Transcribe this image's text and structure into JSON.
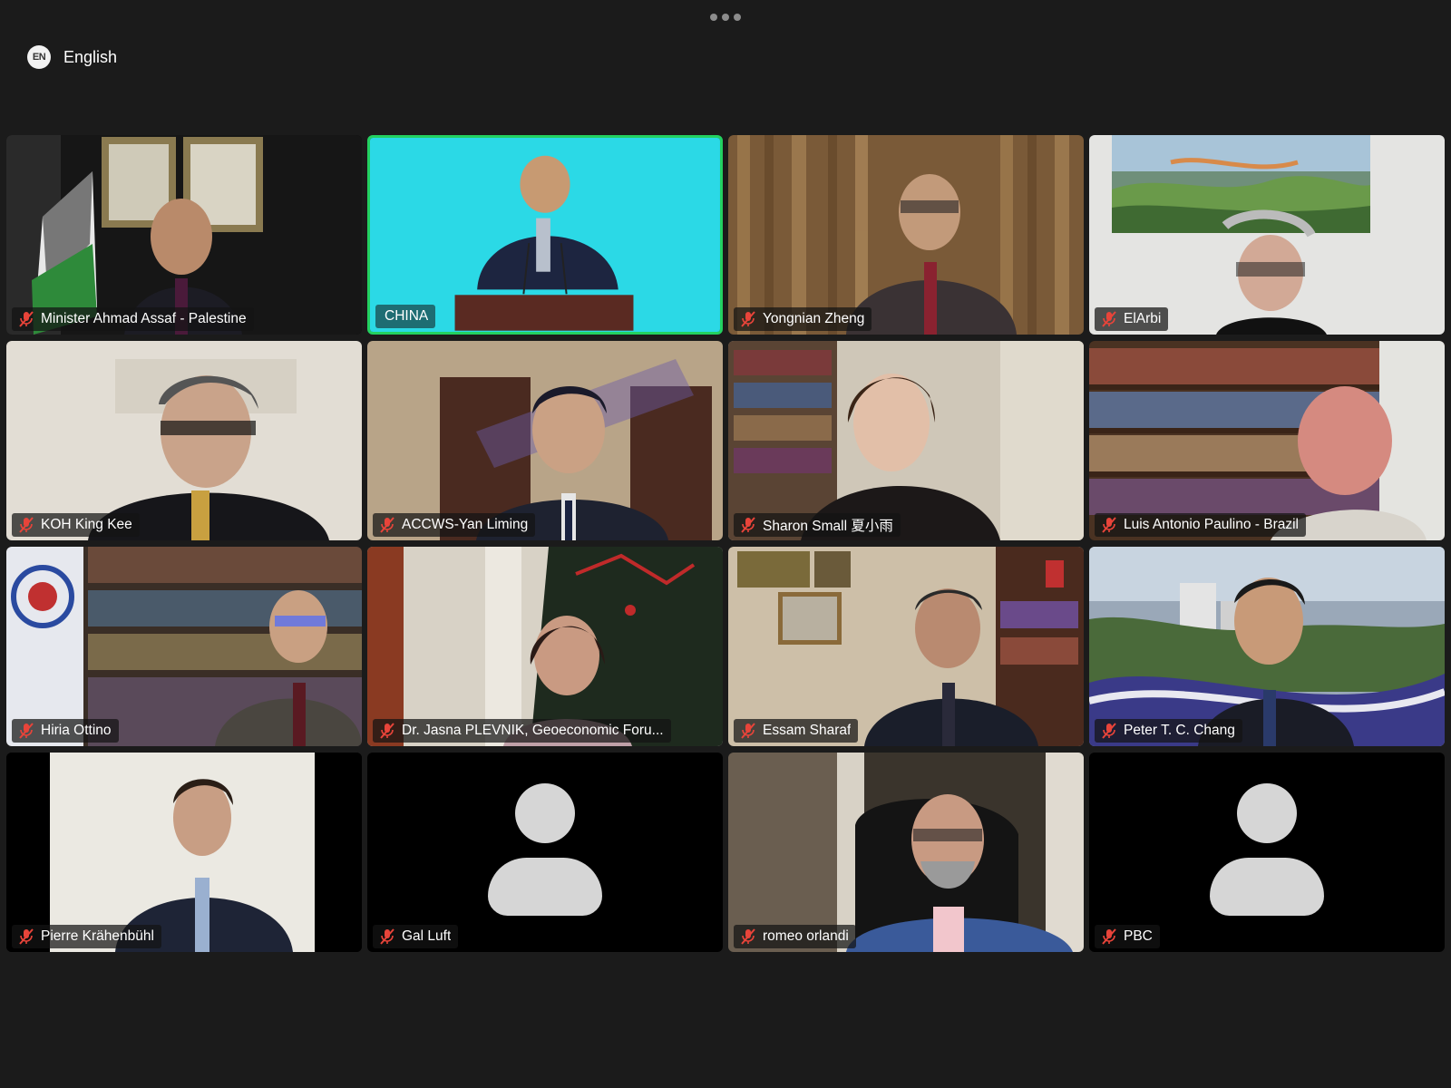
{
  "top_bar": {
    "more_icon": "more-horizontal-icon",
    "language": {
      "badge": "EN",
      "label": "English"
    }
  },
  "participants": [
    {
      "name": "Minister Ahmad Assaf - Palestine",
      "muted": true,
      "video": "office-flag-portraits"
    },
    {
      "name": "CHINA",
      "muted": false,
      "active_speaker": true,
      "video": "speaker-at-podium-cyan"
    },
    {
      "name": "Yongnian Zheng",
      "muted": true,
      "video": "curtain-background"
    },
    {
      "name": "ElArbi",
      "muted": true,
      "video": "painting-background"
    },
    {
      "name": "KOH King Kee",
      "muted": true,
      "video": "light-room"
    },
    {
      "name": "ACCWS-Yan Liming",
      "muted": true,
      "video": "room-doors"
    },
    {
      "name": "Sharon Small 夏小雨",
      "muted": true,
      "video": "bookshelf-room"
    },
    {
      "name": "Luis Antonio Paulino - Brazil",
      "muted": true,
      "video": "bookshelf-wall"
    },
    {
      "name": "Hiria Ottino",
      "muted": true,
      "video": "flag-bookshelf"
    },
    {
      "name": "Dr. Jasna PLEVNIK,  Geoeconomic Foru...",
      "muted": true,
      "video": "christmas-tree"
    },
    {
      "name": "Essam Sharaf",
      "muted": true,
      "video": "paintings-bookshelf"
    },
    {
      "name": "Peter T. C. Chang",
      "muted": true,
      "video": "university-banner"
    },
    {
      "name": "Pierre Krähenbühl",
      "muted": true,
      "video": "white-wall"
    },
    {
      "name": "Gal Luft",
      "muted": true,
      "video": "no-video-avatar"
    },
    {
      "name": "romeo orlandi",
      "muted": true,
      "video": "office-chair"
    },
    {
      "name": "PBC",
      "muted": true,
      "video": "no-video-avatar"
    }
  ],
  "colors": {
    "background": "#1b1b1b",
    "active_speaker_border": "#23d160",
    "muted_icon": "#e8443a",
    "speaker_label_bg": "#1f6f3c"
  }
}
